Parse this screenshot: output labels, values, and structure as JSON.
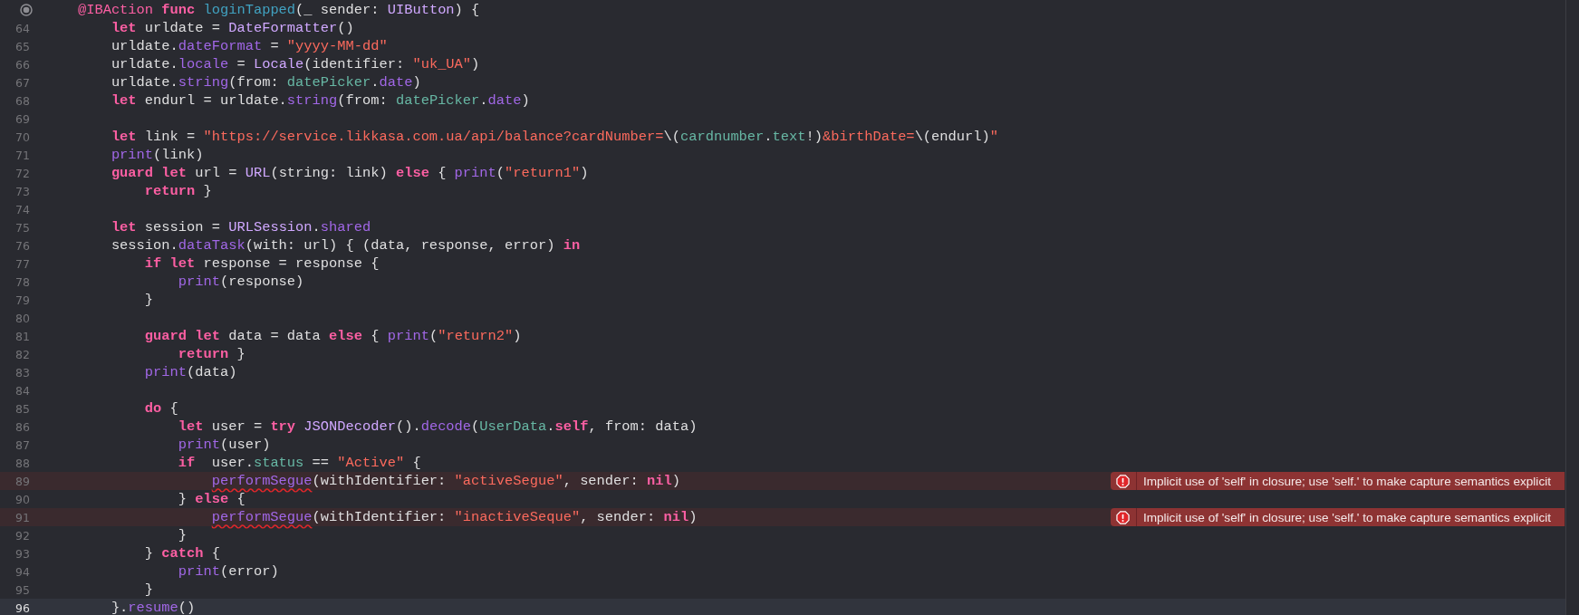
{
  "editor": {
    "lines": [
      {
        "current": false,
        "tokens": [
          {
            "kind": "attr",
            "text": "    @IBAction "
          },
          {
            "kind": "kw",
            "text": "func "
          },
          {
            "kind": "decl",
            "text": "loginTapped"
          },
          {
            "kind": "plain",
            "text": "(_ sender: "
          },
          {
            "kind": "type",
            "text": "UIButton"
          },
          {
            "kind": "plain",
            "text": ") {"
          }
        ]
      },
      {
        "number": "64",
        "current": false,
        "tokens": [
          {
            "kind": "kw",
            "text": "        let"
          },
          {
            "kind": "plain",
            "text": " urldate = "
          },
          {
            "kind": "type",
            "text": "DateFormatter"
          },
          {
            "kind": "plain",
            "text": "()"
          }
        ]
      },
      {
        "number": "65",
        "current": false,
        "tokens": [
          {
            "kind": "plain",
            "text": "        urldate."
          },
          {
            "kind": "fn",
            "text": "dateFormat"
          },
          {
            "kind": "plain",
            "text": " = "
          },
          {
            "kind": "str",
            "text": "\"yyyy-MM-dd\""
          }
        ]
      },
      {
        "number": "66",
        "current": false,
        "tokens": [
          {
            "kind": "plain",
            "text": "        urldate."
          },
          {
            "kind": "fn",
            "text": "locale"
          },
          {
            "kind": "plain",
            "text": " = "
          },
          {
            "kind": "type",
            "text": "Locale"
          },
          {
            "kind": "plain",
            "text": "(identifier: "
          },
          {
            "kind": "str",
            "text": "\"uk_UA\""
          },
          {
            "kind": "plain",
            "text": ")"
          }
        ]
      },
      {
        "number": "67",
        "current": false,
        "tokens": [
          {
            "kind": "plain",
            "text": "        urldate."
          },
          {
            "kind": "fn",
            "text": "string"
          },
          {
            "kind": "plain",
            "text": "(from: "
          },
          {
            "kind": "proj",
            "text": "datePicker"
          },
          {
            "kind": "plain",
            "text": "."
          },
          {
            "kind": "fn",
            "text": "date"
          },
          {
            "kind": "plain",
            "text": ")"
          }
        ]
      },
      {
        "number": "68",
        "current": false,
        "tokens": [
          {
            "kind": "kw",
            "text": "        let"
          },
          {
            "kind": "plain",
            "text": " endurl = urldate."
          },
          {
            "kind": "fn",
            "text": "string"
          },
          {
            "kind": "plain",
            "text": "(from: "
          },
          {
            "kind": "proj",
            "text": "datePicker"
          },
          {
            "kind": "plain",
            "text": "."
          },
          {
            "kind": "fn",
            "text": "date"
          },
          {
            "kind": "plain",
            "text": ")"
          }
        ]
      },
      {
        "number": "69",
        "current": false
      },
      {
        "number": "70",
        "current": false,
        "tokens": [
          {
            "kind": "kw",
            "text": "        let"
          },
          {
            "kind": "plain",
            "text": " link = "
          },
          {
            "kind": "str",
            "text": "\"https://service.likkasa.com.ua/api/balance?cardNumber="
          },
          {
            "kind": "plain",
            "text": "\\("
          },
          {
            "kind": "proj",
            "text": "cardnumber"
          },
          {
            "kind": "plain",
            "text": "."
          },
          {
            "kind": "proj",
            "text": "text"
          },
          {
            "kind": "plain",
            "text": "!)"
          },
          {
            "kind": "str",
            "text": "&birthDate="
          },
          {
            "kind": "plain",
            "text": "\\(endurl)"
          },
          {
            "kind": "str",
            "text": "\""
          }
        ]
      },
      {
        "number": "71",
        "current": false,
        "tokens": [
          {
            "kind": "fn",
            "text": "        print"
          },
          {
            "kind": "plain",
            "text": "(link)"
          }
        ]
      },
      {
        "number": "72",
        "current": false,
        "tokens": [
          {
            "kind": "kw",
            "text": "        guard let"
          },
          {
            "kind": "plain",
            "text": " url = "
          },
          {
            "kind": "type",
            "text": "URL"
          },
          {
            "kind": "plain",
            "text": "(string: link) "
          },
          {
            "kind": "kw",
            "text": "else"
          },
          {
            "kind": "plain",
            "text": " { "
          },
          {
            "kind": "fn",
            "text": "print"
          },
          {
            "kind": "plain",
            "text": "("
          },
          {
            "kind": "str",
            "text": "\"return1\""
          },
          {
            "kind": "plain",
            "text": ")"
          }
        ]
      },
      {
        "number": "73",
        "current": false,
        "tokens": [
          {
            "kind": "kw",
            "text": "            return"
          },
          {
            "kind": "plain",
            "text": " }"
          }
        ]
      },
      {
        "number": "74",
        "current": false
      },
      {
        "number": "75",
        "current": false,
        "tokens": [
          {
            "kind": "kw",
            "text": "        let"
          },
          {
            "kind": "plain",
            "text": " session = "
          },
          {
            "kind": "type",
            "text": "URLSession"
          },
          {
            "kind": "plain",
            "text": "."
          },
          {
            "kind": "fn",
            "text": "shared"
          }
        ]
      },
      {
        "number": "76",
        "current": false,
        "tokens": [
          {
            "kind": "plain",
            "text": "        session."
          },
          {
            "kind": "fn",
            "text": "dataTask"
          },
          {
            "kind": "plain",
            "text": "(with: url) { (data, response, error) "
          },
          {
            "kind": "kw",
            "text": "in"
          }
        ]
      },
      {
        "number": "77",
        "current": false,
        "tokens": [
          {
            "kind": "kw",
            "text": "            if let"
          },
          {
            "kind": "plain",
            "text": " response = response {"
          }
        ]
      },
      {
        "number": "78",
        "current": false,
        "tokens": [
          {
            "kind": "fn",
            "text": "                print"
          },
          {
            "kind": "plain",
            "text": "(response)"
          }
        ]
      },
      {
        "number": "79",
        "current": false,
        "tokens": [
          {
            "kind": "plain",
            "text": "            }"
          }
        ]
      },
      {
        "number": "80",
        "current": false
      },
      {
        "number": "81",
        "current": false,
        "tokens": [
          {
            "kind": "kw",
            "text": "            guard let"
          },
          {
            "kind": "plain",
            "text": " data = data "
          },
          {
            "kind": "kw",
            "text": "else"
          },
          {
            "kind": "plain",
            "text": " { "
          },
          {
            "kind": "fn",
            "text": "print"
          },
          {
            "kind": "plain",
            "text": "("
          },
          {
            "kind": "str",
            "text": "\"return2\""
          },
          {
            "kind": "plain",
            "text": ")"
          }
        ]
      },
      {
        "number": "82",
        "current": false,
        "tokens": [
          {
            "kind": "kw",
            "text": "                return"
          },
          {
            "kind": "plain",
            "text": " }"
          }
        ]
      },
      {
        "number": "83",
        "current": false,
        "tokens": [
          {
            "kind": "fn",
            "text": "            print"
          },
          {
            "kind": "plain",
            "text": "(data)"
          }
        ]
      },
      {
        "number": "84",
        "current": false
      },
      {
        "number": "85",
        "current": false,
        "tokens": [
          {
            "kind": "kw",
            "text": "            do"
          },
          {
            "kind": "plain",
            "text": " {"
          }
        ]
      },
      {
        "number": "86",
        "current": false,
        "tokens": [
          {
            "kind": "kw",
            "text": "                let"
          },
          {
            "kind": "plain",
            "text": " user = "
          },
          {
            "kind": "kw",
            "text": "try "
          },
          {
            "kind": "type",
            "text": "JSONDecoder"
          },
          {
            "kind": "plain",
            "text": "()."
          },
          {
            "kind": "fn",
            "text": "decode"
          },
          {
            "kind": "plain",
            "text": "("
          },
          {
            "kind": "proj",
            "text": "UserData"
          },
          {
            "kind": "plain",
            "text": "."
          },
          {
            "kind": "kw",
            "text": "self"
          },
          {
            "kind": "plain",
            "text": ", from: data)"
          }
        ]
      },
      {
        "number": "87",
        "current": false,
        "tokens": [
          {
            "kind": "fn",
            "text": "                print"
          },
          {
            "kind": "plain",
            "text": "(user)"
          }
        ]
      },
      {
        "number": "88",
        "current": false,
        "tokens": [
          {
            "kind": "kw",
            "text": "                if"
          },
          {
            "kind": "plain",
            "text": "  user."
          },
          {
            "kind": "proj",
            "text": "status"
          },
          {
            "kind": "plain",
            "text": " == "
          },
          {
            "kind": "str",
            "text": "\"Active\""
          },
          {
            "kind": "plain",
            "text": " {"
          }
        ]
      },
      {
        "number": "89",
        "current": false,
        "issue": {
          "message": "Implicit use of 'self' in closure; use 'self.' to make capture semantics explicit"
        },
        "tokens": [
          {
            "kind": "fn",
            "text": "                    performSegue",
            "underlined": true
          },
          {
            "kind": "plain",
            "text": "(withIdentifier: "
          },
          {
            "kind": "str",
            "text": "\"activeSegue\""
          },
          {
            "kind": "plain",
            "text": ", sender: "
          },
          {
            "kind": "kw",
            "text": "nil"
          },
          {
            "kind": "plain",
            "text": ")"
          }
        ]
      },
      {
        "number": "90",
        "current": false,
        "tokens": [
          {
            "kind": "plain",
            "text": "                } "
          },
          {
            "kind": "kw",
            "text": "else"
          },
          {
            "kind": "plain",
            "text": " {"
          }
        ]
      },
      {
        "number": "91",
        "current": false,
        "issue": {
          "message": "Implicit use of 'self' in closure; use 'self.' to make capture semantics explicit"
        },
        "tokens": [
          {
            "kind": "fn",
            "text": "                    performSegue",
            "underlined": true
          },
          {
            "kind": "plain",
            "text": "(withIdentifier: "
          },
          {
            "kind": "str",
            "text": "\"inactiveSeque\""
          },
          {
            "kind": "plain",
            "text": ", sender: "
          },
          {
            "kind": "kw",
            "text": "nil"
          },
          {
            "kind": "plain",
            "text": ")"
          }
        ]
      },
      {
        "number": "92",
        "current": false,
        "tokens": [
          {
            "kind": "plain",
            "text": "                }"
          }
        ]
      },
      {
        "number": "93",
        "current": false,
        "tokens": [
          {
            "kind": "plain",
            "text": "            } "
          },
          {
            "kind": "kw",
            "text": "catch"
          },
          {
            "kind": "plain",
            "text": " {"
          }
        ]
      },
      {
        "number": "94",
        "current": false,
        "tokens": [
          {
            "kind": "fn",
            "text": "                print"
          },
          {
            "kind": "plain",
            "text": "(error)"
          }
        ]
      },
      {
        "number": "95",
        "current": false,
        "tokens": [
          {
            "kind": "plain",
            "text": "            }"
          }
        ]
      },
      {
        "number": "96",
        "current": true,
        "tokens": [
          {
            "kind": "plain",
            "text": "        }."
          },
          {
            "kind": "fn",
            "text": "resume"
          },
          {
            "kind": "plain",
            "text": "()"
          }
        ]
      }
    ]
  }
}
